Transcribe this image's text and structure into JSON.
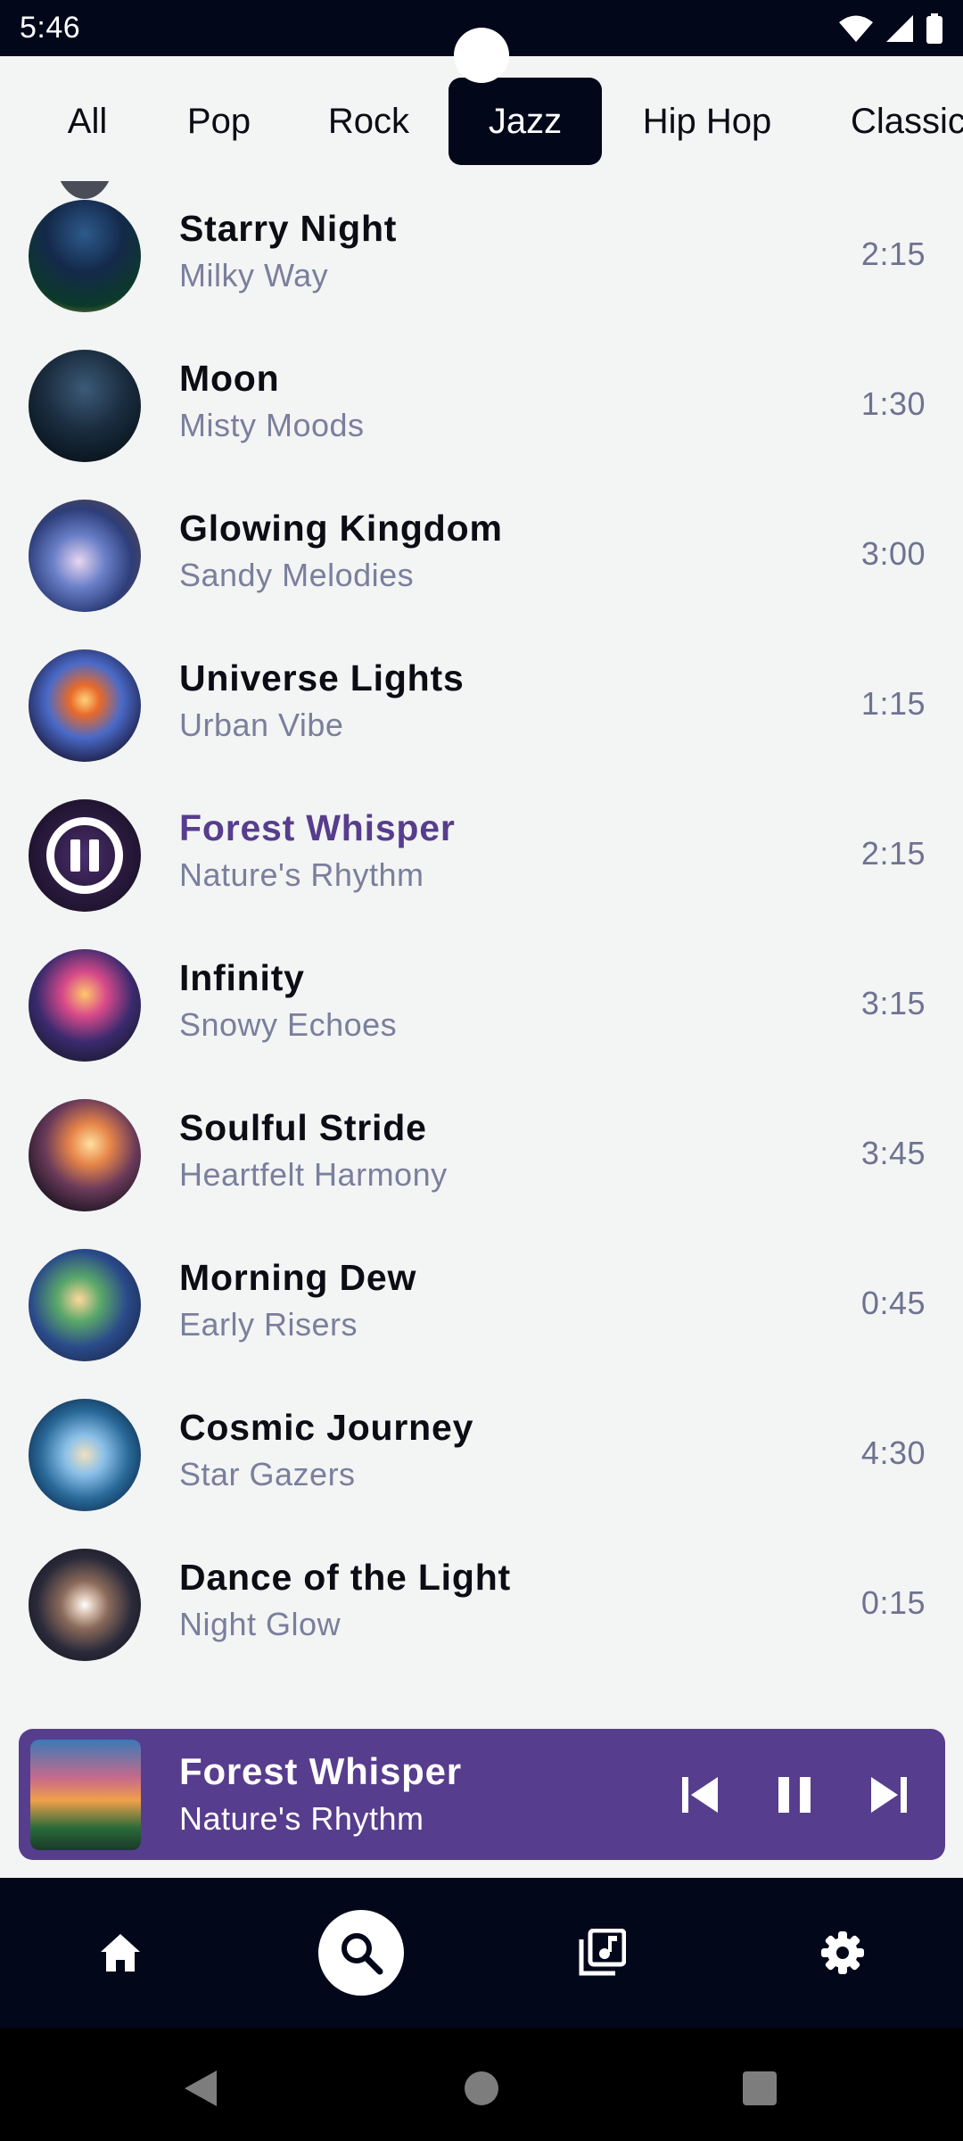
{
  "status_bar": {
    "time": "5:46"
  },
  "tabs": [
    {
      "label": "All",
      "active": false
    },
    {
      "label": "Pop",
      "active": false
    },
    {
      "label": "Rock",
      "active": false
    },
    {
      "label": "Jazz",
      "active": true
    },
    {
      "label": "Hip Hop",
      "active": false
    },
    {
      "label": "Classic",
      "active": false
    }
  ],
  "songs": [
    {
      "title": "Starry Night",
      "artist": "Milky Way",
      "duration": "2:15"
    },
    {
      "title": "Moon",
      "artist": "Misty Moods",
      "duration": "1:30"
    },
    {
      "title": "Glowing Kingdom",
      "artist": "Sandy Melodies",
      "duration": "3:00"
    },
    {
      "title": "Universe Lights",
      "artist": "Urban Vibe",
      "duration": "1:15"
    },
    {
      "title": "Forest Whisper",
      "artist": "Nature's Rhythm",
      "duration": "2:15",
      "playing": true
    },
    {
      "title": "Infinity",
      "artist": "Snowy Echoes",
      "duration": "3:15"
    },
    {
      "title": "Soulful Stride",
      "artist": "Heartfelt Harmony",
      "duration": "3:45"
    },
    {
      "title": "Morning Dew",
      "artist": "Early Risers",
      "duration": "0:45"
    },
    {
      "title": "Cosmic Journey",
      "artist": "Star Gazers",
      "duration": "4:30"
    },
    {
      "title": "Dance of the Light",
      "artist": "Night Glow",
      "duration": "0:15"
    }
  ],
  "mini_player": {
    "title": "Forest Whisper",
    "artist": "Nature's Rhythm",
    "controls": [
      "skip-previous-icon",
      "pause-icon",
      "skip-next-icon"
    ]
  },
  "bottom_nav": {
    "items": [
      "home-icon",
      "search-icon",
      "library-music-icon",
      "settings-icon"
    ],
    "active": "search-icon"
  },
  "colors": {
    "accent": "#573d8d",
    "dark": "#03071a",
    "background": "#f3f4f4",
    "secondary_text": "#7a7f9c"
  }
}
